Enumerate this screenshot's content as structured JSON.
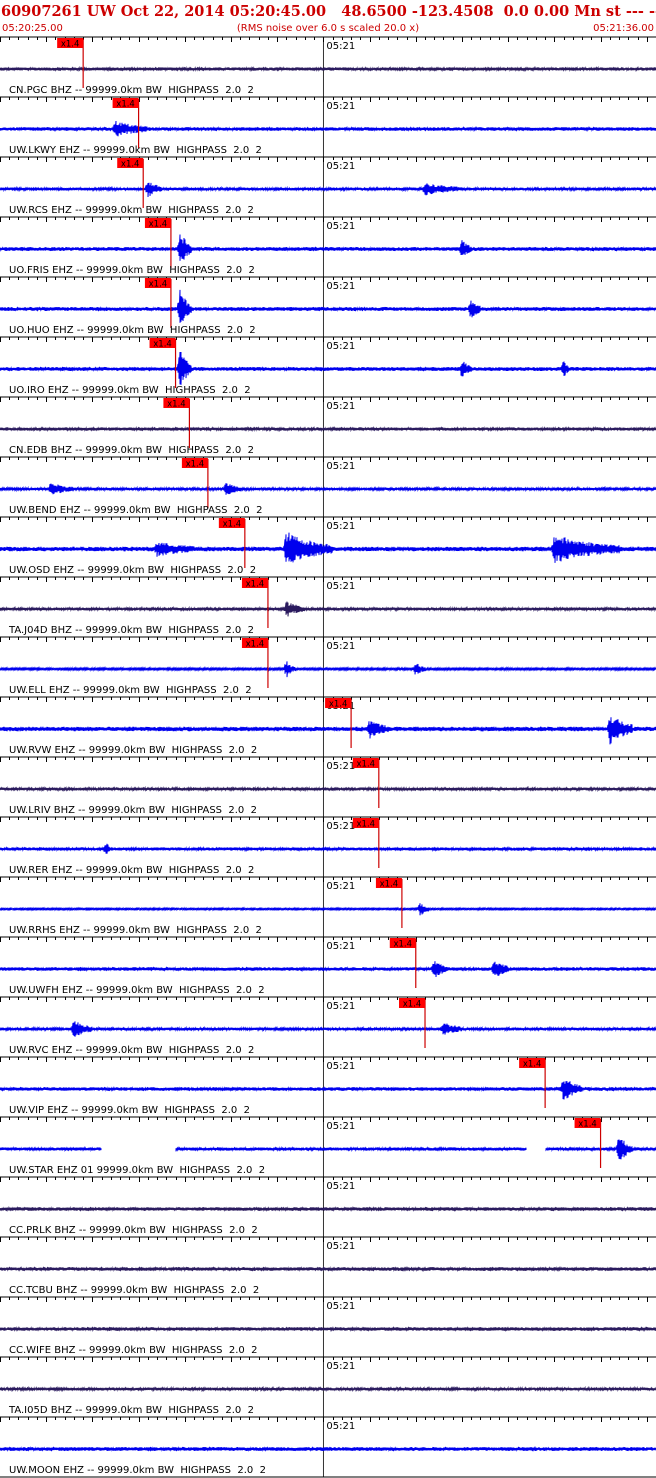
{
  "header": {
    "title": "60907261 UW Oct 22, 2014 05:20:45.00   48.6500 -123.4508  0.0 0.00 Mn st --- -- --   -1",
    "start_time": "05:20:25.00",
    "subtitle": "(RMS noise over 6.0 s scaled 20.0 x)",
    "end_time": "05:21:36.00"
  },
  "colors": {
    "title": "#cc0000",
    "background": "#ffffff",
    "axis": "#000000",
    "pick_box": "#ff0000",
    "pick_line": "#cc0000",
    "trace_blue": "#0000ee",
    "trace_purple": "#2a1a5e"
  },
  "chart_data": {
    "type": "line",
    "time_range": [
      "05:20:25.00",
      "05:21:36.00"
    ],
    "minute_label": "05:21",
    "pick_label": "x1.4",
    "traces": [
      {
        "label": "CN.PGC BHZ -- 99999.0km BW  HIGHPASS  2.0  2",
        "pick_s": 9.0,
        "color": "purple",
        "amp": 0.5,
        "bursts": []
      },
      {
        "label": "UW.LKWY EHZ -- 99999.0km BW  HIGHPASS  2.0  2",
        "pick_s": 15.0,
        "color": "blue",
        "amp": 0.55,
        "bursts": [
          [
            12.5,
            3.5,
            2.2
          ]
        ]
      },
      {
        "label": "UW.RCS EHZ -- 99999.0km BW  HIGHPASS  2.0  2",
        "pick_s": 15.5,
        "color": "blue",
        "amp": 0.45,
        "bursts": [
          [
            16.0,
            1.5,
            2.5
          ],
          [
            46,
            4,
            1.6
          ]
        ]
      },
      {
        "label": "UO.FRIS EHZ -- 99999.0km BW  HIGHPASS  2.0  2",
        "pick_s": 18.5,
        "color": "blue",
        "amp": 0.6,
        "bursts": [
          [
            19.5,
            1.2,
            6
          ],
          [
            50,
            1,
            2.5
          ]
        ]
      },
      {
        "label": "UO.HUO EHZ -- 99999.0km BW  HIGHPASS  2.0  2",
        "pick_s": 18.5,
        "color": "blue",
        "amp": 0.6,
        "bursts": [
          [
            19.5,
            1.2,
            6
          ],
          [
            51,
            1,
            3
          ]
        ]
      },
      {
        "label": "UO.IRO EHZ -- 99999.0km BW  HIGHPASS  2.0  2",
        "pick_s": 19.0,
        "color": "blue",
        "amp": 0.6,
        "bursts": [
          [
            19.5,
            1.2,
            6
          ],
          [
            50,
            1,
            2.5
          ],
          [
            61,
            0.5,
            2.5
          ]
        ]
      },
      {
        "label": "CN.EDB BHZ -- 99999.0km BW  HIGHPASS  2.0  2",
        "pick_s": 20.5,
        "color": "purple",
        "amp": 0.5,
        "bursts": []
      },
      {
        "label": "UW.BEND EHZ -- 99999.0km BW  HIGHPASS  2.0  2",
        "pick_s": 22.5,
        "color": "blue",
        "amp": 0.4,
        "bursts": [
          [
            5.5,
            2.5,
            1.8
          ],
          [
            24.5,
            1.5,
            2
          ]
        ]
      },
      {
        "label": "UW.OSD EHZ -- 99999.0km BW  HIGHPASS  2.0  2",
        "pick_s": 26.5,
        "color": "blue",
        "amp": 0.7,
        "bursts": [
          [
            17,
            4,
            1.8
          ],
          [
            31,
            5,
            5
          ],
          [
            60,
            7,
            4
          ]
        ]
      },
      {
        "label": "TA.J04D BHZ -- 99999.0km BW  HIGHPASS  2.0  2",
        "pick_s": 29.0,
        "color": "purple",
        "amp": 0.45,
        "bursts": [
          [
            31,
            2,
            2.2
          ]
        ]
      },
      {
        "label": "UW.ELL EHZ -- 99999.0km BW  HIGHPASS  2.0  2",
        "pick_s": 29.0,
        "color": "blue",
        "amp": 0.3,
        "bursts": [
          [
            31,
            1,
            2.5
          ],
          [
            45,
            1,
            2
          ]
        ]
      },
      {
        "label": "UW.RVW EHZ -- 99999.0km BW  HIGHPASS  2.0  2",
        "pick_s": 38.0,
        "color": "blue",
        "amp": 0.7,
        "bursts": [
          [
            40,
            2,
            2.5
          ],
          [
            66,
            2.5,
            4.5
          ]
        ]
      },
      {
        "label": "UW.LRIV BHZ -- 99999.0km BW  HIGHPASS  2.0  2",
        "pick_s": 41.0,
        "color": "purple",
        "amp": 0.45,
        "bursts": []
      },
      {
        "label": "UW.RER EHZ -- 99999.0km BW  HIGHPASS  2.0  2",
        "pick_s": 41.0,
        "color": "blue",
        "amp": 0.5,
        "bursts": [
          [
            11.5,
            0.4,
            2.5
          ]
        ]
      },
      {
        "label": "UW.RRHS EHZ -- 99999.0km BW  HIGHPASS  2.0  2",
        "pick_s": 43.5,
        "color": "blue",
        "amp": 0.25,
        "bursts": [
          [
            45.5,
            1,
            2
          ]
        ]
      },
      {
        "label": "UW.UWFH EHZ -- 99999.0km BW  HIGHPASS  2.0  2",
        "pick_s": 45.0,
        "color": "blue",
        "amp": 0.55,
        "bursts": [
          [
            47,
            1.5,
            2.5
          ],
          [
            53.5,
            1.5,
            3
          ]
        ]
      },
      {
        "label": "UW.RVC EHZ -- 99999.0km BW  HIGHPASS  2.0  2",
        "pick_s": 46.0,
        "color": "blue",
        "amp": 0.45,
        "bursts": [
          [
            8,
            2,
            2.5
          ],
          [
            48,
            2,
            2
          ]
        ]
      },
      {
        "label": "UW.VIP EHZ -- 99999.0km BW  HIGHPASS  2.0  2",
        "pick_s": 59.0,
        "color": "blue",
        "amp": 0.55,
        "bursts": [
          [
            61,
            2,
            3.5
          ]
        ]
      },
      {
        "label": "UW.STAR EHZ 01 99999.0km BW  HIGHPASS  2.0  2",
        "pick_s": 65.0,
        "color": "blue",
        "amp": 0.5,
        "bursts": [
          [
            67,
            1.5,
            4
          ]
        ],
        "gaps": [
          [
            11,
            19
          ],
          [
            57,
            59
          ]
        ]
      },
      {
        "label": "CC.PRLK BHZ -- 99999.0km BW  HIGHPASS  2.0  2",
        "pick_s": null,
        "color": "purple",
        "amp": 0.55,
        "bursts": []
      },
      {
        "label": "CC.TCBU BHZ -- 99999.0km BW  HIGHPASS  2.0  2",
        "pick_s": null,
        "color": "purple",
        "amp": 0.55,
        "bursts": []
      },
      {
        "label": "CC.WIFE BHZ -- 99999.0km BW  HIGHPASS  2.0  2",
        "pick_s": null,
        "color": "purple",
        "amp": 0.55,
        "bursts": []
      },
      {
        "label": "TA.I05D BHZ -- 99999.0km BW  HIGHPASS  2.0  2",
        "pick_s": null,
        "color": "purple",
        "amp": 0.45,
        "bursts": []
      },
      {
        "label": "UW.MOON EHZ -- 99999.0km BW  HIGHPASS  2.0  2",
        "pick_s": null,
        "color": "blue",
        "amp": 0.6,
        "bursts": []
      }
    ]
  }
}
